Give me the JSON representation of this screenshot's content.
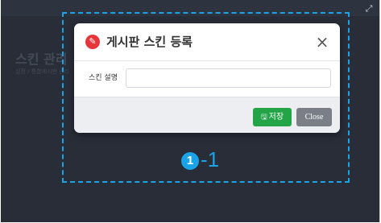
{
  "background": {
    "page_title": "스킨 관리",
    "breadcrumb": "설정 / 통합게시판 관리"
  },
  "modal": {
    "title": "게시판 스킨 등록",
    "close_symbol": "×",
    "field_label": "스킨 설명",
    "field_value": "",
    "save_label": "저장",
    "close_label": "Close"
  },
  "annotation": {
    "step_number": "1",
    "step_suffix": "-1",
    "color": "#1aa3e6"
  },
  "icons": {
    "modal_title_icon": "pencil-circle-icon",
    "save_icon": "floppy-disk-icon",
    "expand_icon": "expand-icon"
  },
  "colors": {
    "save_button": "#23a547",
    "close_button": "#7a7f87",
    "title_icon": "#e5373b"
  }
}
